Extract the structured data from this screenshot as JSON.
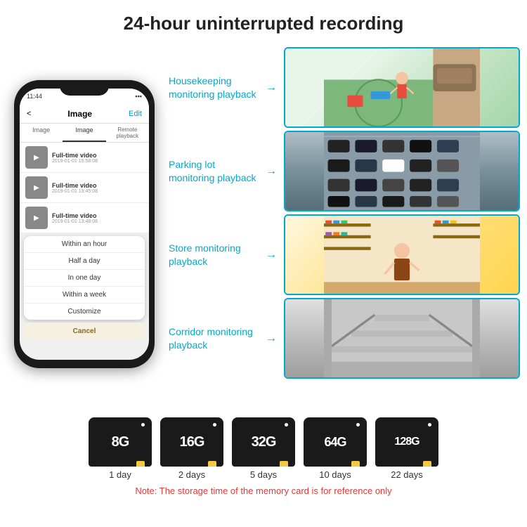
{
  "header": {
    "title": "24-hour uninterrupted recording"
  },
  "phone": {
    "status_time": "11:44",
    "nav_title": "Image",
    "nav_edit": "Edit",
    "nav_back": "<",
    "tabs": [
      "Image",
      "Image",
      "Remote playback"
    ],
    "videos": [
      {
        "title": "Full-time video",
        "time": "2019-01-01 15:58:08"
      },
      {
        "title": "Full-time video",
        "time": "2019-01-01 13:45:08"
      },
      {
        "title": "Full-time video",
        "time": "2019-01-01 13:48:08"
      }
    ],
    "dropdown_items": [
      "Within an hour",
      "Half a day",
      "In one day",
      "Within a week",
      "Customize"
    ],
    "cancel_label": "Cancel"
  },
  "monitoring": [
    {
      "label": "Housekeeping\nmonitoring playback",
      "scene": "kids"
    },
    {
      "label": "Parking lot\nmonitoring playback",
      "scene": "parking"
    },
    {
      "label": "Store monitoring\nplayback",
      "scene": "store"
    },
    {
      "label": "Corridor monitoring\nplayback",
      "scene": "corridor"
    }
  ],
  "storage": {
    "cards": [
      {
        "size": "8G",
        "days": "1 day"
      },
      {
        "size": "16G",
        "days": "2 days"
      },
      {
        "size": "32G",
        "days": "5 days"
      },
      {
        "size": "64G",
        "days": "10 days"
      },
      {
        "size": "128G",
        "days": "22 days"
      }
    ],
    "note": "Note: The storage time of the memory card is for reference only"
  }
}
